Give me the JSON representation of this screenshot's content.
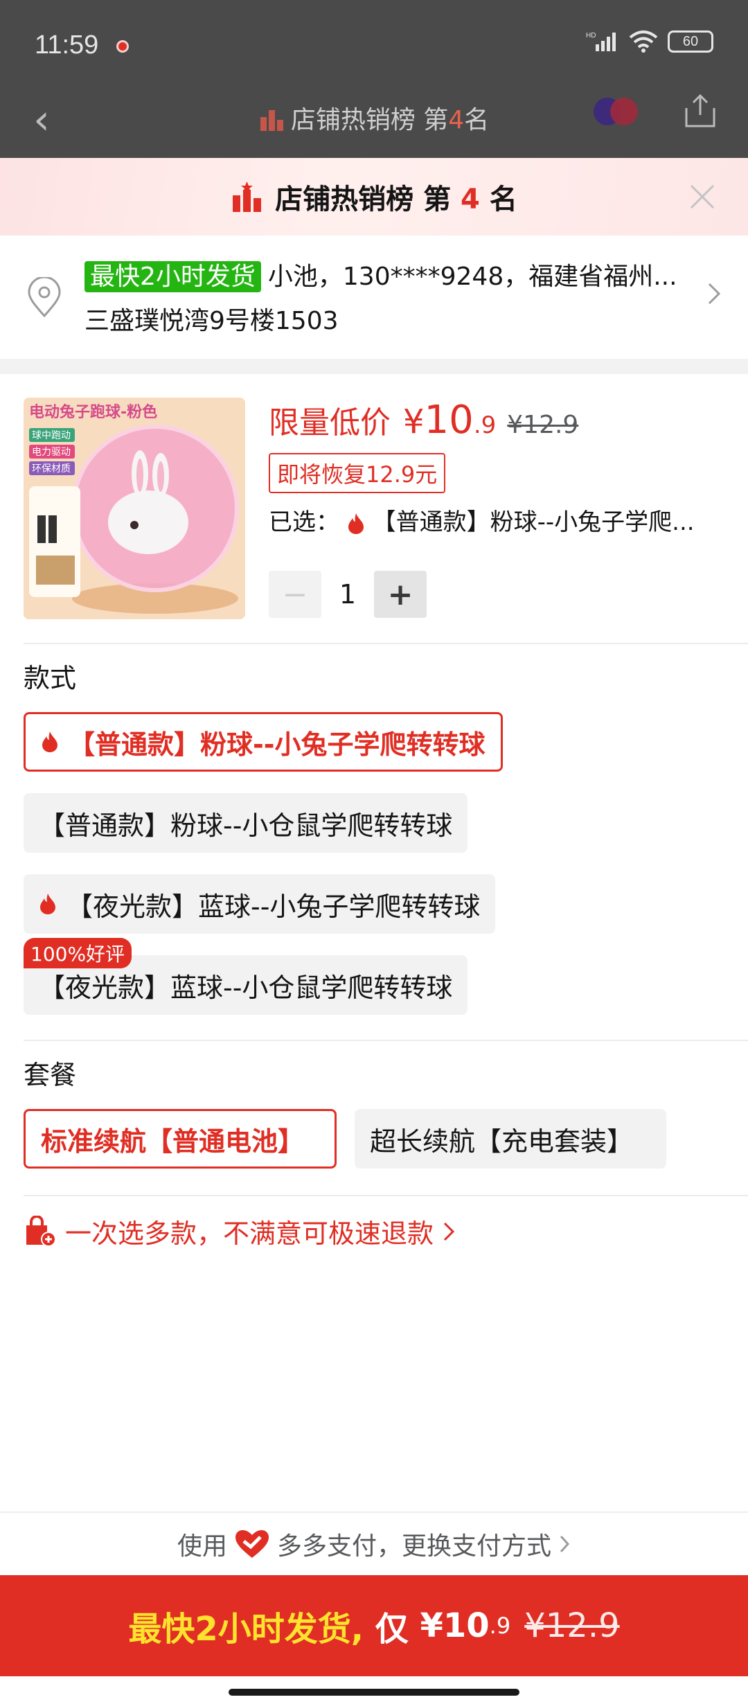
{
  "status_bar": {
    "time": "11:59",
    "battery": "60",
    "network": "HD"
  },
  "behind": {
    "title_prefix": "店铺热销榜 第",
    "rank": "4",
    "title_suffix": "名"
  },
  "rank_banner": {
    "prefix": "店铺热销榜 第",
    "rank": "4",
    "suffix": "名"
  },
  "address": {
    "tag": "最快2小时发货",
    "line1": "小池，130****9248，福建省福州...",
    "line2": "三盛璞悦湾9号楼1503"
  },
  "product": {
    "image_title": "电动兔子跑球-粉色",
    "image_features": [
      "球中跑动",
      "电力驱动",
      "环保材质"
    ],
    "price_label": "限量低价",
    "currency": "¥",
    "price_int": "10",
    "price_dec": ".9",
    "price_orig": "¥12.9",
    "restore_tag": "即将恢复12.9元",
    "selected_prefix": "已选：",
    "selected_value": "【普通款】粉球--小兔子学爬...",
    "quantity": "1",
    "minus": "−",
    "plus": "+"
  },
  "style_section": {
    "title": "款式",
    "options": [
      {
        "label": "【普通款】粉球--小兔子学爬转转球",
        "selected": true,
        "hot": true
      },
      {
        "label": "【普通款】粉球--小仓鼠学爬转转球",
        "selected": false,
        "hot": false
      },
      {
        "label": "【夜光款】蓝球--小兔子学爬转转球",
        "selected": false,
        "hot": true
      },
      {
        "label": "【夜光款】蓝球--小仓鼠学爬转转球",
        "selected": false,
        "hot": false,
        "badge": "100%好评"
      }
    ]
  },
  "package_section": {
    "title": "套餐",
    "options": [
      {
        "label": "标准续航【普通电池】",
        "selected": true
      },
      {
        "label": "超长续航【充电套装】",
        "selected": false
      }
    ]
  },
  "multi_select": {
    "text": "一次选多款，不满意可极速退款"
  },
  "pay": {
    "prefix": "使用",
    "method": "多多支付，更换支付方式"
  },
  "buy_button": {
    "fast": "最快2小时发货,",
    "only": "仅",
    "currency": "¥",
    "price_int": "10",
    "price_dec": ".9",
    "orig": "¥12.9"
  },
  "colors": {
    "accent": "#e02e24",
    "green_tag": "#25b513",
    "yellow": "#fde32e"
  }
}
